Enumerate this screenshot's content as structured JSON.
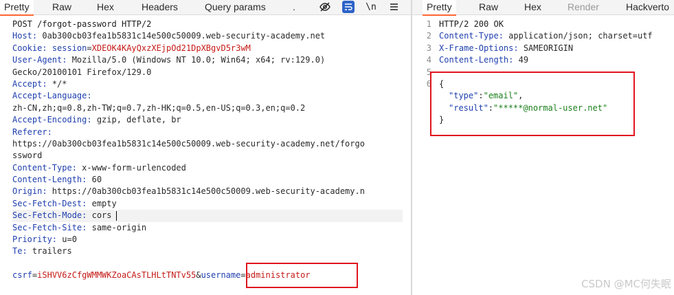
{
  "request": {
    "tabs": [
      "Pretty",
      "Raw",
      "Hex",
      "Headers",
      "Query params",
      "."
    ],
    "active_tab": "Pretty",
    "icons": [
      "eye-slash-icon",
      "wrap-lines-icon",
      "newline-icon",
      "hamburger-menu-icon"
    ],
    "newline_glyph": "\\n",
    "request_line": "POST /forgot-password HTTP/2",
    "headers": [
      {
        "name": "Host:",
        "value": " 0ab300cb03fea1b5831c14e500c50009.web-security-academy.net"
      },
      {
        "name": "Cookie:",
        "value": " ",
        "cookie_name": "session",
        "cookie_eq": "=",
        "cookie_value": "XDEOK4KAyQxzXEjpOd21DpXBgvD5r3wM"
      },
      {
        "name": "User-Agent:",
        "value": " Mozilla/5.0 (Windows NT 10.0; Win64; x64; rv:129.0)",
        "continued": [
          "Gecko/20100101 Firefox/129.0"
        ]
      },
      {
        "name": "Accept:",
        "value": " */*"
      },
      {
        "name": "Accept-Language:",
        "value": "",
        "continued": [
          "zh-CN,zh;q=0.8,zh-TW;q=0.7,zh-HK;q=0.5,en-US;q=0.3,en;q=0.2"
        ]
      },
      {
        "name": "Accept-Encoding:",
        "value": " gzip, deflate, br"
      },
      {
        "name": "Referer:",
        "value": "",
        "continued": [
          "https://0ab300cb03fea1b5831c14e500c50009.web-security-academy.net/forgo",
          "ssword"
        ]
      },
      {
        "name": "Content-Type:",
        "value": " x-www-form-urlencoded"
      },
      {
        "name": "Content-Length:",
        "value": " 60"
      },
      {
        "name": "Origin:",
        "value": " https://0ab300cb03fea1b5831c14e500c50009.web-security-academy.n"
      },
      {
        "name": "Sec-Fetch-Dest:",
        "value": " empty"
      },
      {
        "name": "Sec-Fetch-Mode:",
        "value": " cors",
        "highlighted": true
      },
      {
        "name": "Sec-Fetch-Site:",
        "value": " same-origin"
      },
      {
        "name": "Priority:",
        "value": " u=0"
      },
      {
        "name": "Te:",
        "value": " trailers"
      }
    ],
    "body": {
      "p1_name": "csrf",
      "eq": "=",
      "p1_value": "iSHVV6zCfgWMMWKZoaCAsTLHLtTNTv55",
      "amp": "&",
      "p2_name": "username",
      "p2_value": "administrator"
    }
  },
  "response": {
    "tabs": [
      "Pretty",
      "Raw",
      "Hex",
      "Render",
      "Hackverto"
    ],
    "active_tab": "Pretty",
    "disabled_tab": "Render",
    "line_numbers": [
      "1",
      "2",
      "3",
      "4",
      "5",
      "6"
    ],
    "status_line": "HTTP/2 200 OK",
    "headers": [
      {
        "name": "Content-Type:",
        "value": " application/json; charset=utf"
      },
      {
        "name": "X-Frame-Options:",
        "value": " SAMEORIGIN"
      },
      {
        "name": "Content-Length:",
        "value": " 49"
      }
    ],
    "json": {
      "open": "{",
      "close": "}",
      "k1": "\"type\"",
      "v1": "\"email\"",
      "k2": "\"result\"",
      "v2": "\"*****@normal-user.net\"",
      "colon": ":",
      "comma": ","
    }
  },
  "highlight_color": "#e0141e",
  "watermark": "CSDN @MC何失眠"
}
